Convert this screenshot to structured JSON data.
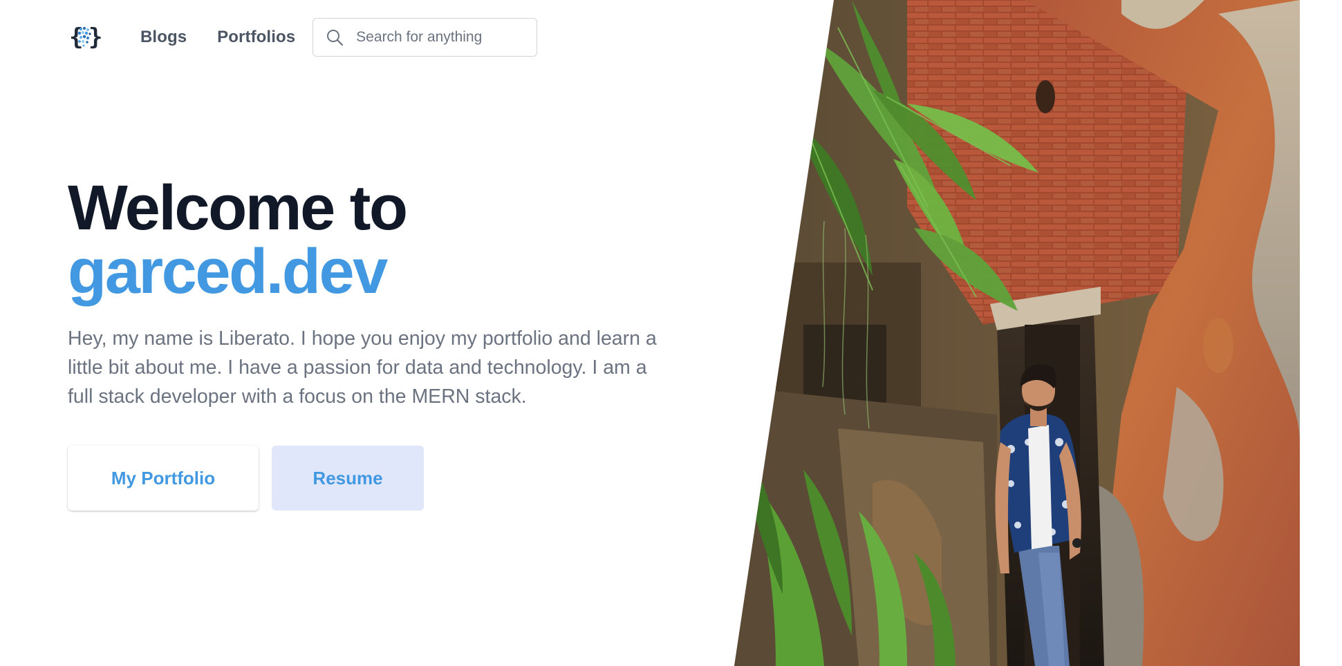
{
  "nav": {
    "logo_icon": "curly-braces-dots-logo",
    "links": [
      {
        "label": "Blogs"
      },
      {
        "label": "Portfolios"
      }
    ],
    "search": {
      "placeholder": "Search for anything",
      "value": "",
      "icon": "search-icon"
    }
  },
  "hero": {
    "title_line1": "Welcome to",
    "title_line2": "garced.dev",
    "description": "Hey, my name is Liberato. I hope you enjoy my portfolio and learn a little bit about me. I have a passion for data and technology. I am a full stack developer with a focus on the MERN stack.",
    "primary_button": "My Portfolio",
    "secondary_button": "Resume"
  },
  "colors": {
    "accent": "#4299e1",
    "title": "#111827",
    "body_text": "#6b7280",
    "secondary_button_bg": "#e0e7fb"
  }
}
